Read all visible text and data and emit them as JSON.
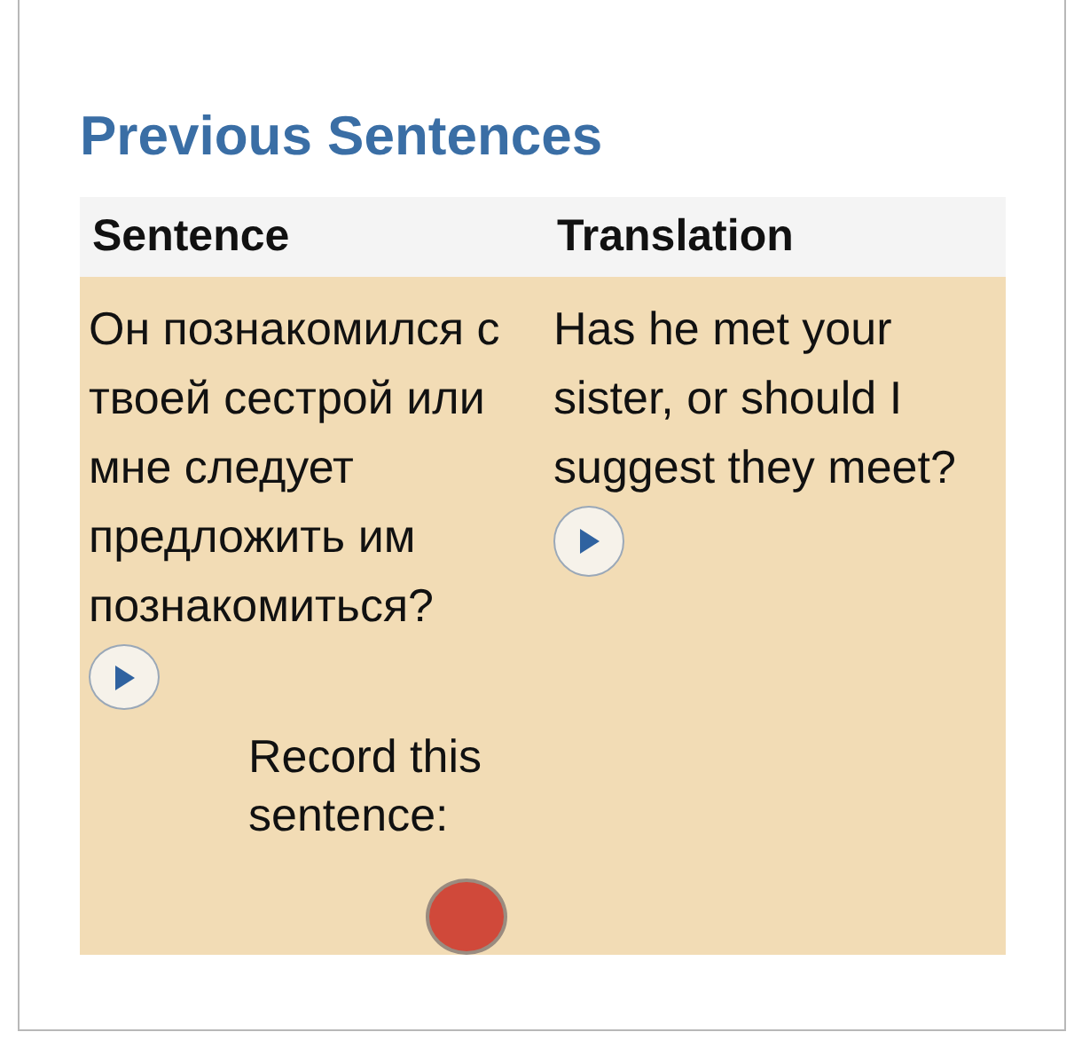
{
  "title": "Previous Sentences",
  "table": {
    "columns": [
      "Sentence",
      "Translation"
    ],
    "rows": [
      {
        "sentence": "Он познакомился с твоей сестрой или мне следует предложить им познакомиться?",
        "translation": "Has he met your sister, or should I suggest they meet?",
        "record_label": "Record this sentence:"
      }
    ]
  }
}
